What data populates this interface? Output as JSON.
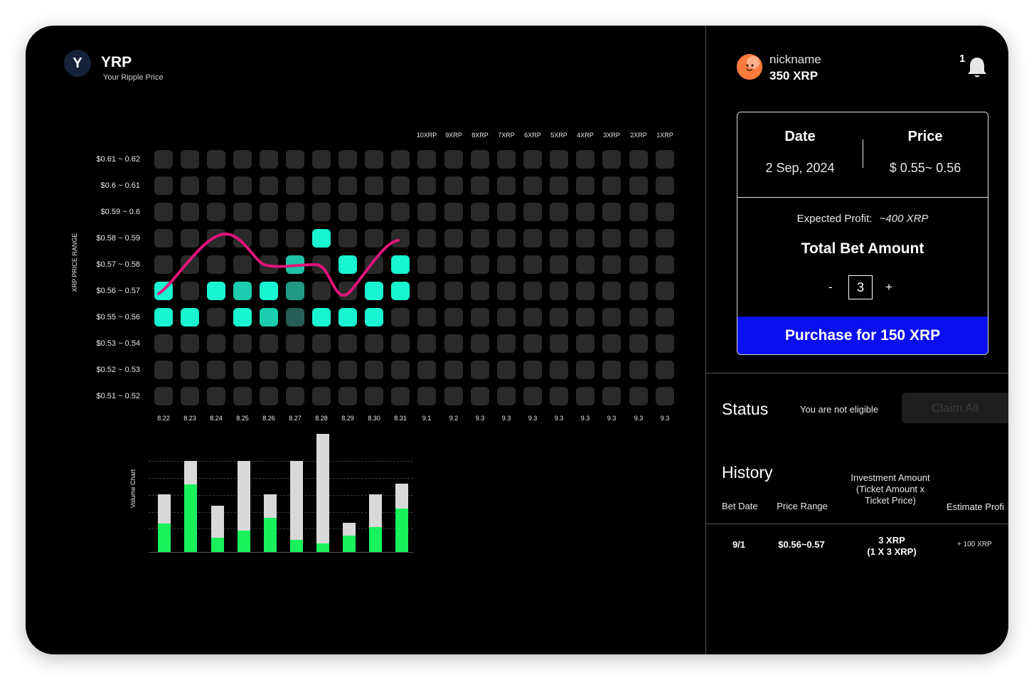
{
  "app": {
    "logo_letter": "Y",
    "title": "YRP",
    "subtitle": "Your Ripple Price"
  },
  "grid": {
    "y_axis_label": "XRP PRICE RANGE",
    "row_labels": [
      "$0.61 ~ 0.62",
      "$0.6 ~ 0.61",
      "$0.59 ~ 0.6",
      "$0.58 ~ 0.59",
      "$0.57 ~ 0.58",
      "$0.56 ~ 0.57",
      "$0.55 ~ 0.56",
      "$0.53 ~ 0.54",
      "$0.52 ~ 0.53",
      "$0.51 ~ 0.52"
    ],
    "payout_labels": [
      "10XRP",
      "9XRP",
      "8XRP",
      "7XRP",
      "6XRP",
      "5XRP",
      "4XRP",
      "3XRP",
      "2XRP",
      "1XRP"
    ],
    "date_labels": [
      "8.22",
      "8.23",
      "8.24",
      "8.25",
      "8.26",
      "8.27",
      "8.28",
      "8.29",
      "8.30",
      "8.31",
      "9.1",
      "9.2",
      "9.3",
      "9.3",
      "9.3",
      "9.3",
      "9.3",
      "9.3",
      "9.3",
      "9.3"
    ],
    "highlighted_cells": [
      {
        "col": 6,
        "row": 3,
        "level": 1.0
      },
      {
        "col": 5,
        "row": 4,
        "level": 0.75
      },
      {
        "col": 7,
        "row": 4,
        "level": 1.0
      },
      {
        "col": 9,
        "row": 4,
        "level": 1.0
      },
      {
        "col": 0,
        "row": 5,
        "level": 1.0
      },
      {
        "col": 2,
        "row": 5,
        "level": 1.0
      },
      {
        "col": 3,
        "row": 5,
        "level": 0.8
      },
      {
        "col": 4,
        "row": 5,
        "level": 1.0
      },
      {
        "col": 5,
        "row": 5,
        "level": 0.55
      },
      {
        "col": 8,
        "row": 5,
        "level": 1.0
      },
      {
        "col": 9,
        "row": 5,
        "level": 1.0
      },
      {
        "col": 0,
        "row": 6,
        "level": 1.0
      },
      {
        "col": 1,
        "row": 6,
        "level": 1.0
      },
      {
        "col": 3,
        "row": 6,
        "level": 1.0
      },
      {
        "col": 4,
        "row": 6,
        "level": 0.8
      },
      {
        "col": 5,
        "row": 6,
        "level": 0.25
      },
      {
        "col": 6,
        "row": 6,
        "level": 1.0
      },
      {
        "col": 7,
        "row": 6,
        "level": 1.0
      },
      {
        "col": 8,
        "row": 6,
        "level": 1.0
      }
    ],
    "highlight_color": "#19f5d0",
    "price_line_color": "#e0157a"
  },
  "volume_chart": {
    "label": "Volume Chart",
    "total_color": "#d9d9d9",
    "green_color": "#19f25b",
    "bars": [
      {
        "total": 49,
        "green": 24
      },
      {
        "total": 77,
        "green": 57
      },
      {
        "total": 39,
        "green": 12
      },
      {
        "total": 77,
        "green": 18
      },
      {
        "total": 49,
        "green": 29
      },
      {
        "total": 77,
        "green": 10
      },
      {
        "total": 100,
        "green": 7
      },
      {
        "total": 25,
        "green": 14
      },
      {
        "total": 49,
        "green": 21
      },
      {
        "total": 58,
        "green": 37
      }
    ]
  },
  "user": {
    "nickname": "nickname",
    "balance": "350 XRP",
    "notification_count": "1"
  },
  "bet": {
    "date_label": "Date",
    "date_value": "2 Sep, 2024",
    "price_label": "Price",
    "price_value": "$ 0.55~ 0.56",
    "expected_profit_label": "Expected Profit:",
    "expected_profit_value": "~400 XRP",
    "total_label": "Total Bet Amount",
    "minus": "-",
    "plus": "+",
    "quantity": "3",
    "purchase_label": "Purchase for 150 XRP"
  },
  "status": {
    "title": "Status",
    "message": "You are not eligible",
    "claim_label": "Claim All"
  },
  "history": {
    "title": "History",
    "headers": [
      "Bet Date",
      "Price Range",
      "Investment Amount (Ticket Amount x Ticket Price)",
      "Estimate Profi"
    ],
    "rows": [
      {
        "date": "9/1",
        "range": "$0.56~0.57",
        "investment_line1": "3 XRP",
        "investment_line2": "(1 X 3 XRP)",
        "profit": "+ 100 XRP"
      }
    ]
  }
}
